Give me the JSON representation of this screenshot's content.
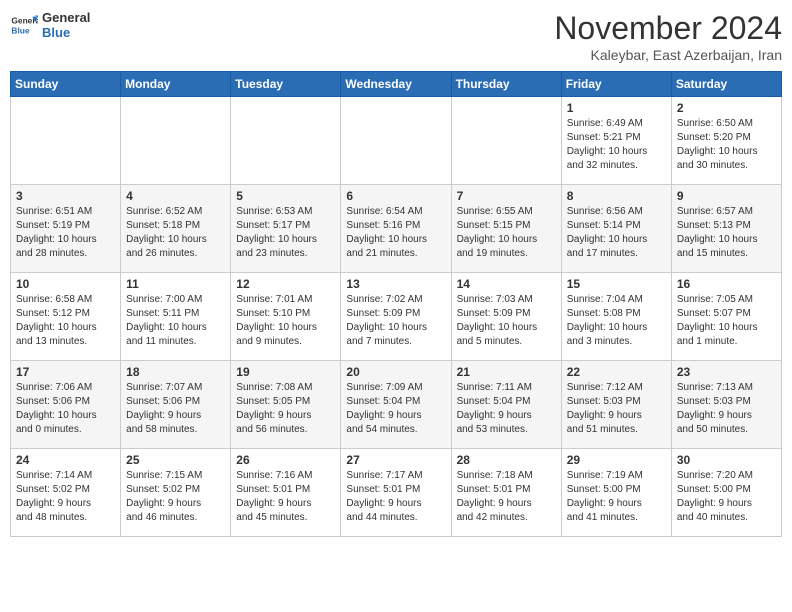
{
  "header": {
    "logo_line1": "General",
    "logo_line2": "Blue",
    "month_title": "November 2024",
    "subtitle": "Kaleybar, East Azerbaijan, Iran"
  },
  "weekdays": [
    "Sunday",
    "Monday",
    "Tuesday",
    "Wednesday",
    "Thursday",
    "Friday",
    "Saturday"
  ],
  "weeks": [
    [
      {
        "day": "",
        "info": ""
      },
      {
        "day": "",
        "info": ""
      },
      {
        "day": "",
        "info": ""
      },
      {
        "day": "",
        "info": ""
      },
      {
        "day": "",
        "info": ""
      },
      {
        "day": "1",
        "info": "Sunrise: 6:49 AM\nSunset: 5:21 PM\nDaylight: 10 hours\nand 32 minutes."
      },
      {
        "day": "2",
        "info": "Sunrise: 6:50 AM\nSunset: 5:20 PM\nDaylight: 10 hours\nand 30 minutes."
      }
    ],
    [
      {
        "day": "3",
        "info": "Sunrise: 6:51 AM\nSunset: 5:19 PM\nDaylight: 10 hours\nand 28 minutes."
      },
      {
        "day": "4",
        "info": "Sunrise: 6:52 AM\nSunset: 5:18 PM\nDaylight: 10 hours\nand 26 minutes."
      },
      {
        "day": "5",
        "info": "Sunrise: 6:53 AM\nSunset: 5:17 PM\nDaylight: 10 hours\nand 23 minutes."
      },
      {
        "day": "6",
        "info": "Sunrise: 6:54 AM\nSunset: 5:16 PM\nDaylight: 10 hours\nand 21 minutes."
      },
      {
        "day": "7",
        "info": "Sunrise: 6:55 AM\nSunset: 5:15 PM\nDaylight: 10 hours\nand 19 minutes."
      },
      {
        "day": "8",
        "info": "Sunrise: 6:56 AM\nSunset: 5:14 PM\nDaylight: 10 hours\nand 17 minutes."
      },
      {
        "day": "9",
        "info": "Sunrise: 6:57 AM\nSunset: 5:13 PM\nDaylight: 10 hours\nand 15 minutes."
      }
    ],
    [
      {
        "day": "10",
        "info": "Sunrise: 6:58 AM\nSunset: 5:12 PM\nDaylight: 10 hours\nand 13 minutes."
      },
      {
        "day": "11",
        "info": "Sunrise: 7:00 AM\nSunset: 5:11 PM\nDaylight: 10 hours\nand 11 minutes."
      },
      {
        "day": "12",
        "info": "Sunrise: 7:01 AM\nSunset: 5:10 PM\nDaylight: 10 hours\nand 9 minutes."
      },
      {
        "day": "13",
        "info": "Sunrise: 7:02 AM\nSunset: 5:09 PM\nDaylight: 10 hours\nand 7 minutes."
      },
      {
        "day": "14",
        "info": "Sunrise: 7:03 AM\nSunset: 5:09 PM\nDaylight: 10 hours\nand 5 minutes."
      },
      {
        "day": "15",
        "info": "Sunrise: 7:04 AM\nSunset: 5:08 PM\nDaylight: 10 hours\nand 3 minutes."
      },
      {
        "day": "16",
        "info": "Sunrise: 7:05 AM\nSunset: 5:07 PM\nDaylight: 10 hours\nand 1 minute."
      }
    ],
    [
      {
        "day": "17",
        "info": "Sunrise: 7:06 AM\nSunset: 5:06 PM\nDaylight: 10 hours\nand 0 minutes."
      },
      {
        "day": "18",
        "info": "Sunrise: 7:07 AM\nSunset: 5:06 PM\nDaylight: 9 hours\nand 58 minutes."
      },
      {
        "day": "19",
        "info": "Sunrise: 7:08 AM\nSunset: 5:05 PM\nDaylight: 9 hours\nand 56 minutes."
      },
      {
        "day": "20",
        "info": "Sunrise: 7:09 AM\nSunset: 5:04 PM\nDaylight: 9 hours\nand 54 minutes."
      },
      {
        "day": "21",
        "info": "Sunrise: 7:11 AM\nSunset: 5:04 PM\nDaylight: 9 hours\nand 53 minutes."
      },
      {
        "day": "22",
        "info": "Sunrise: 7:12 AM\nSunset: 5:03 PM\nDaylight: 9 hours\nand 51 minutes."
      },
      {
        "day": "23",
        "info": "Sunrise: 7:13 AM\nSunset: 5:03 PM\nDaylight: 9 hours\nand 50 minutes."
      }
    ],
    [
      {
        "day": "24",
        "info": "Sunrise: 7:14 AM\nSunset: 5:02 PM\nDaylight: 9 hours\nand 48 minutes."
      },
      {
        "day": "25",
        "info": "Sunrise: 7:15 AM\nSunset: 5:02 PM\nDaylight: 9 hours\nand 46 minutes."
      },
      {
        "day": "26",
        "info": "Sunrise: 7:16 AM\nSunset: 5:01 PM\nDaylight: 9 hours\nand 45 minutes."
      },
      {
        "day": "27",
        "info": "Sunrise: 7:17 AM\nSunset: 5:01 PM\nDaylight: 9 hours\nand 44 minutes."
      },
      {
        "day": "28",
        "info": "Sunrise: 7:18 AM\nSunset: 5:01 PM\nDaylight: 9 hours\nand 42 minutes."
      },
      {
        "day": "29",
        "info": "Sunrise: 7:19 AM\nSunset: 5:00 PM\nDaylight: 9 hours\nand 41 minutes."
      },
      {
        "day": "30",
        "info": "Sunrise: 7:20 AM\nSunset: 5:00 PM\nDaylight: 9 hours\nand 40 minutes."
      }
    ]
  ]
}
